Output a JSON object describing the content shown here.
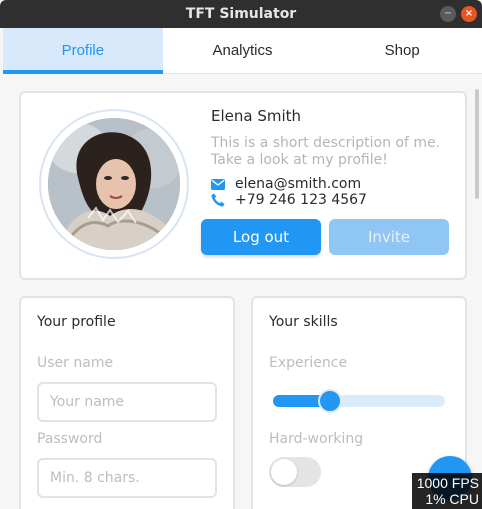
{
  "window": {
    "title": "TFT Simulator"
  },
  "tabs": [
    {
      "label": "Profile",
      "active": true
    },
    {
      "label": "Analytics",
      "active": false
    },
    {
      "label": "Shop",
      "active": false
    }
  ],
  "profile": {
    "name": "Elena Smith",
    "description": "This is a short description of me. Take a look at my profile!",
    "email": "elena@smith.com",
    "phone": "+79 246 123 4567",
    "logout_label": "Log out",
    "invite_label": "Invite"
  },
  "your_profile": {
    "title": "Your profile",
    "username_label": "User name",
    "username_placeholder": "Your name",
    "password_label": "Password",
    "password_placeholder": "Min. 8 chars."
  },
  "your_skills": {
    "title": "Your skills",
    "experience_label": "Experience",
    "experience_value": 0.33,
    "hardworking_label": "Hard-working",
    "hardworking_on": false
  },
  "perf": {
    "fps": "1000 FPS",
    "cpu": "1% CPU"
  },
  "colors": {
    "accent": "#2196f3",
    "tab_active_bg": "#d7e9fb",
    "titlebar": "#2f2f2f",
    "close": "#e95420"
  },
  "icons": [
    "minimize-icon",
    "close-icon",
    "email-icon",
    "phone-icon",
    "avatar-photo"
  ]
}
